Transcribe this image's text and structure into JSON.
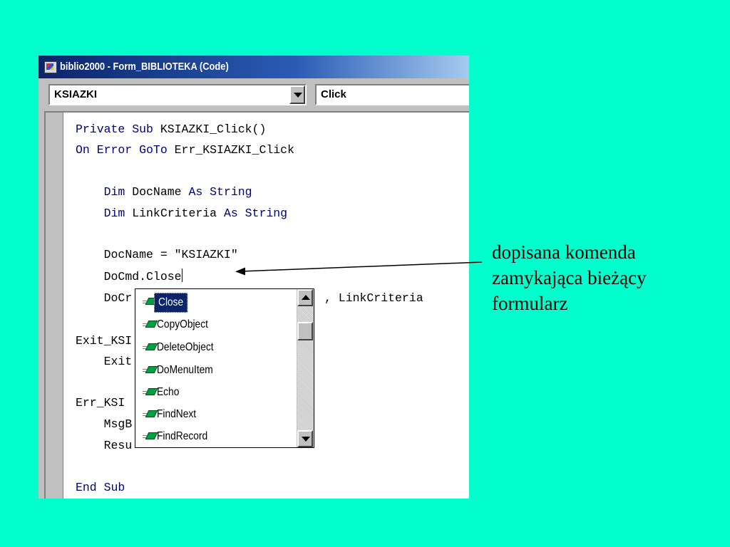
{
  "window": {
    "title": "biblio2000 - Form_BIBLIOTEKA (Code)",
    "object_combo": "KSIAZKI",
    "procedure_combo": "Click"
  },
  "code": {
    "lines": [
      {
        "pre": "",
        "kw1": "Private Sub",
        "mid": " KSIAZKI_Click()",
        "kw2": "",
        "post": ""
      },
      {
        "pre": "",
        "kw1": "On Error GoTo",
        "mid": " Err_KSIAZKI_Click",
        "kw2": "",
        "post": ""
      },
      {
        "pre": "    ",
        "kw1": "Dim",
        "mid": " DocName ",
        "kw2": "As String",
        "post": ""
      },
      {
        "pre": "    ",
        "kw1": "Dim",
        "mid": " LinkCriteria ",
        "kw2": "As String",
        "post": ""
      },
      {
        "pre": "    ",
        "kw1": "",
        "mid": "DocName = \"KSIAZKI\"",
        "kw2": "",
        "post": ""
      },
      {
        "pre": "    ",
        "kw1": "",
        "mid": "DoCmd.Close",
        "kw2": "",
        "post": ""
      },
      {
        "pre": "    ",
        "kw1": "",
        "mid": "DoCr",
        "kw2": "",
        "post": ""
      },
      {
        "pre": "",
        "kw1": "",
        "mid": "Exit_KSI",
        "kw2": "",
        "post": ""
      },
      {
        "pre": "    ",
        "kw1": "",
        "mid": "Exit",
        "kw2": "",
        "post": ""
      },
      {
        "pre": "",
        "kw1": "",
        "mid": "Err_KSI",
        "kw2": "",
        "post": ""
      },
      {
        "pre": "    ",
        "kw1": "",
        "mid": "MsgB",
        "kw2": "",
        "post": ""
      },
      {
        "pre": "    ",
        "kw1": "",
        "mid": "Resu",
        "kw2": "",
        "post": ""
      },
      {
        "pre": "",
        "kw1": "End Sub",
        "mid": "",
        "kw2": "",
        "post": ""
      }
    ],
    "docmd_tail": ", LinkCriteria"
  },
  "autolist": {
    "items": [
      "Close",
      "CopyObject",
      "DeleteObject",
      "DoMenuItem",
      "Echo",
      "FindNext",
      "FindRecord"
    ],
    "selected": "Close",
    "item_icon": "method-icon"
  },
  "annotation": {
    "lines": [
      "dopisana komenda",
      "zamykająca bieżący",
      "formularz"
    ]
  },
  "colors": {
    "background": "#00ffcc",
    "keyword": "#00007f",
    "selection": "#0a246a"
  }
}
